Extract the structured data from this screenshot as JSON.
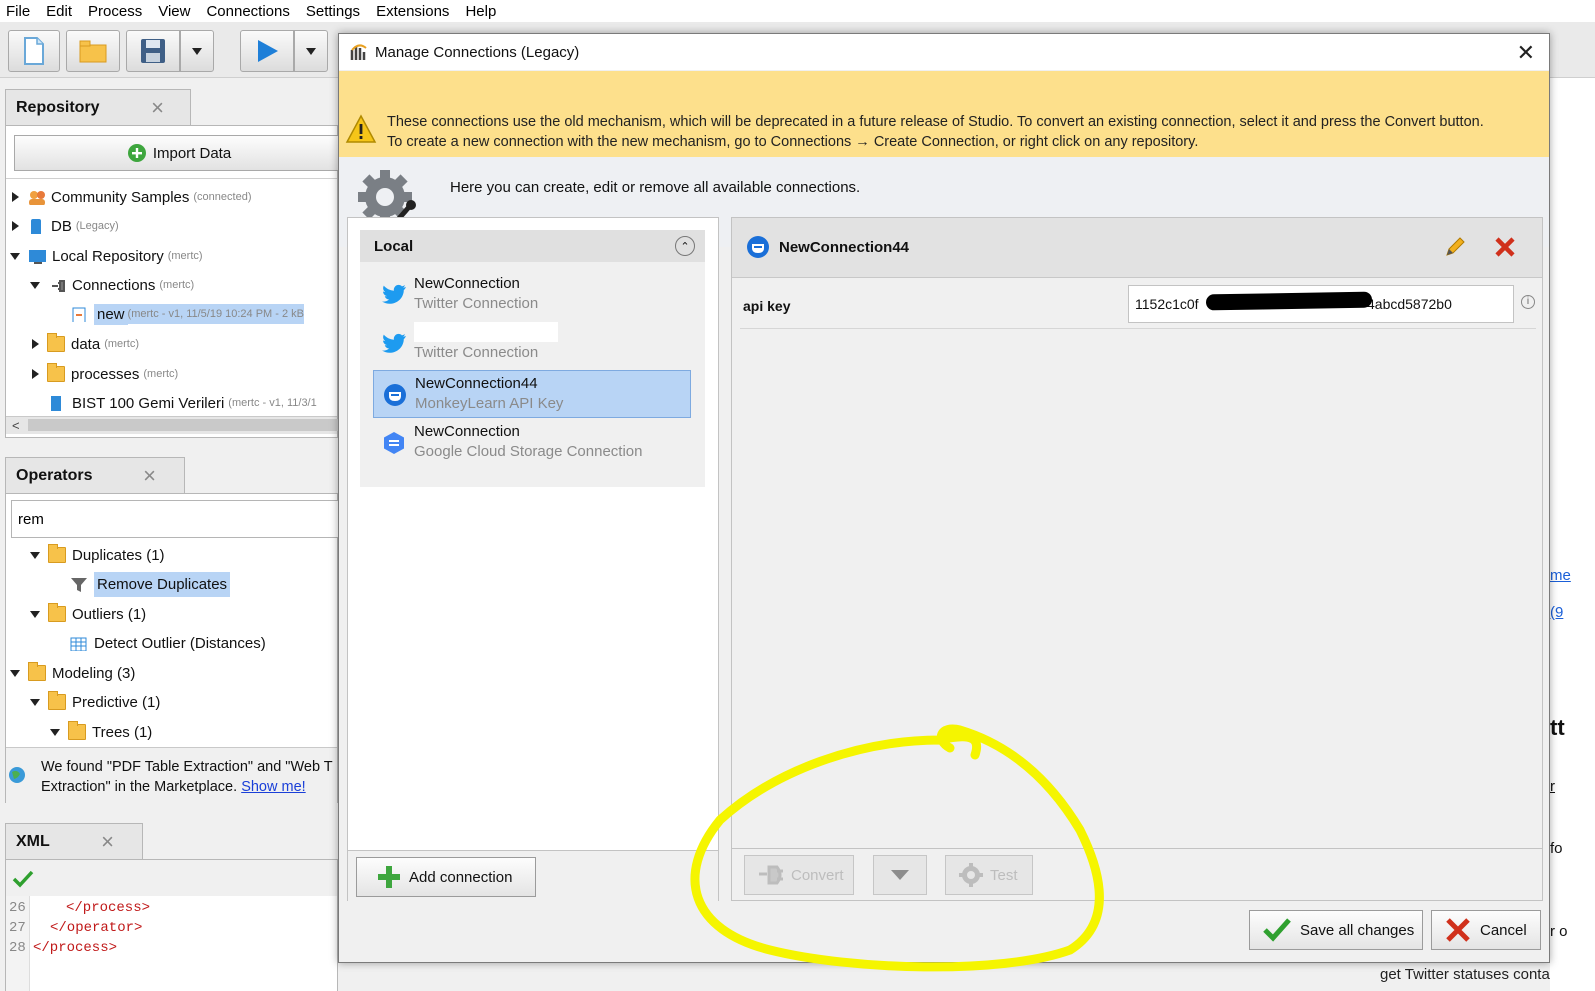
{
  "menu": [
    "File",
    "Edit",
    "Process",
    "View",
    "Connections",
    "Settings",
    "Extensions",
    "Help"
  ],
  "repository": {
    "tab_label": "Repository",
    "import_label": "Import Data",
    "items": [
      {
        "label": "Community Samples",
        "note": "(connected)"
      },
      {
        "label": "DB",
        "note": "(Legacy)"
      },
      {
        "label": "Local Repository",
        "note": "(mertc)"
      },
      {
        "label": "Connections",
        "note": "(mertc)"
      },
      {
        "label": "new",
        "note": "(mertc - v1, 11/5/19 10:24 PM - 2 kB"
      },
      {
        "label": "data",
        "note": "(mertc)"
      },
      {
        "label": "processes",
        "note": "(mertc)"
      },
      {
        "label": "BIST 100 Gemi Verileri",
        "note": "(mertc - v1, 11/3/1"
      }
    ]
  },
  "operators": {
    "tab_label": "Operators",
    "search_value": "rem",
    "items": [
      {
        "label": "Duplicates (1)"
      },
      {
        "label": "Remove Duplicates"
      },
      {
        "label": "Outliers (1)"
      },
      {
        "label": "Detect Outlier (Distances)"
      },
      {
        "label": "Modeling (3)"
      },
      {
        "label": "Predictive (1)"
      },
      {
        "label": "Trees (1)"
      }
    ],
    "marketplace_text_1": "We found \"PDF Table Extraction\" and \"Web T",
    "marketplace_text_2": "Extraction\" in the Marketplace.",
    "marketplace_link": "Show me!"
  },
  "xml": {
    "tab_label": "XML",
    "lines": [
      {
        "num": "26",
        "code": "</process>"
      },
      {
        "num": "27",
        "code": "</operator>"
      },
      {
        "num": "28",
        "code": "</process>"
      }
    ]
  },
  "right_partial": {
    "t1": "me",
    "t2": "(9",
    "t3": "tt",
    "t4": "r",
    "t5": "fo",
    "t6": "r o",
    "t7": "get Twitter statuses conta"
  },
  "dialog": {
    "title": "Manage Connections (Legacy)",
    "warning_line1": "These connections use the old mechanism, which will be deprecated in a future release of Studio. To convert an existing connection, select it and press the Convert button.",
    "warning_line2": "To create a new connection with the new mechanism, go to Connections → Create Connection, or right click on any repository.",
    "info_text": "Here you can create, edit or remove all available connections.",
    "group_label": "Local",
    "connections": [
      {
        "name": "NewConnection",
        "type": "Twitter Connection",
        "icon": "twitter-icon"
      },
      {
        "name": "",
        "type": "Twitter Connection",
        "icon": "twitter-icon"
      },
      {
        "name": "NewConnection44",
        "type": "MonkeyLearn API Key",
        "icon": "monkeylearn-icon"
      },
      {
        "name": "NewConnection",
        "type": "Google Cloud Storage Connection",
        "icon": "google-cloud-icon"
      }
    ],
    "add_connection_label": "Add connection",
    "selected_title": "NewConnection44",
    "property_label": "api key",
    "property_value_prefix": "1152c1c0f",
    "property_value_suffix": "4abcd5872b0",
    "convert_label": "Convert",
    "test_label": "Test",
    "save_label": "Save all changes",
    "cancel_label": "Cancel"
  },
  "colors": {
    "warning_bg": "#fde08c",
    "selection_bg": "#b8d4f5",
    "annotation": "#f5f500"
  }
}
